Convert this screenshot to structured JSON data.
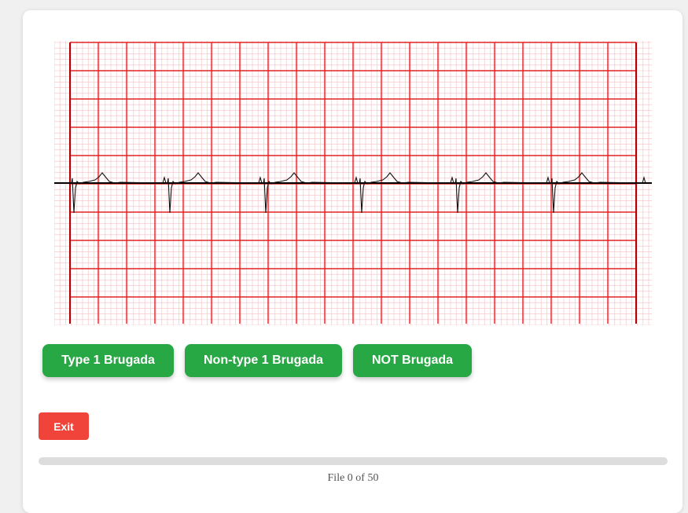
{
  "ecg_viewer": {
    "grid_minor_color": "#f4a6b0",
    "grid_major_color": "#e32222",
    "grid_border_color": "#b30000",
    "baseline_color": "#000000",
    "trace_color": "#111111",
    "beats": 6
  },
  "choices": [
    {
      "label": "Type 1 Brugada"
    },
    {
      "label": "Non-type 1 Brugada"
    },
    {
      "label": "NOT Brugada"
    }
  ],
  "colors": {
    "choice_button": "#28a745",
    "exit_button": "#f0443a",
    "progress_track": "#dddddd",
    "progress_fill": "#28a745"
  },
  "exit_label": "Exit",
  "progress": {
    "current": 0,
    "total": 50,
    "text": "File 0 of 50"
  }
}
